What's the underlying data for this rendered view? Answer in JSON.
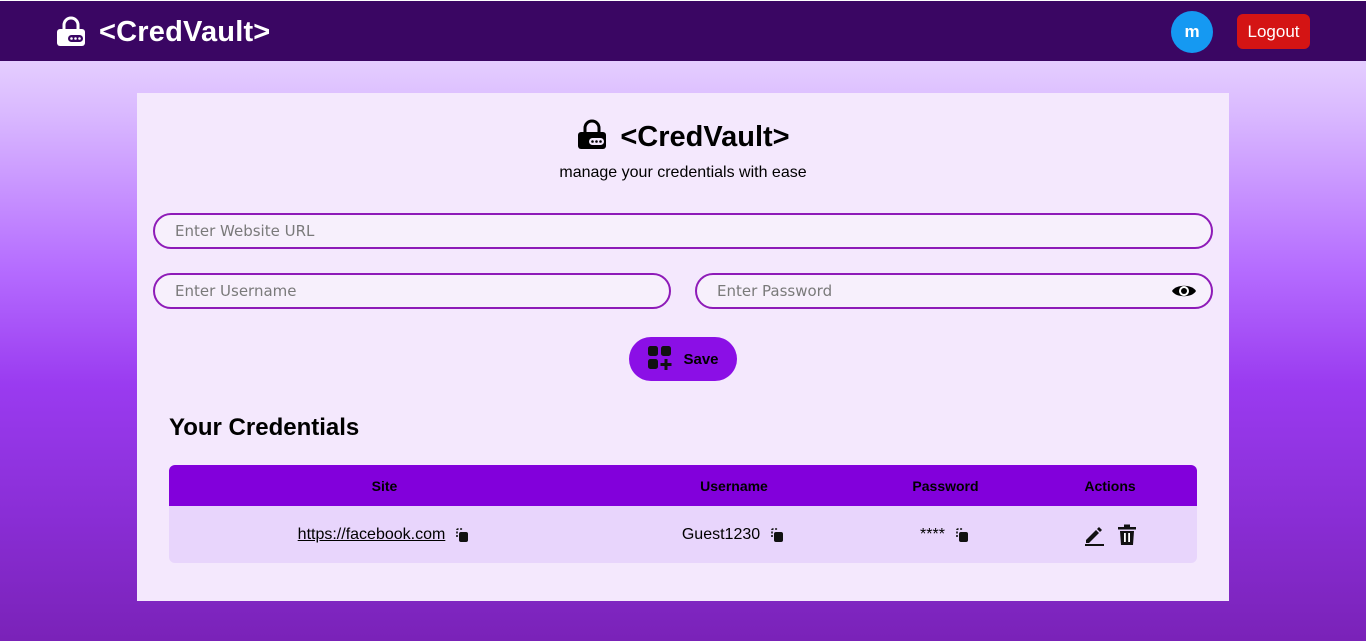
{
  "nav": {
    "brand": "<CredVault>",
    "avatar_letter": "m",
    "logout_label": "Logout"
  },
  "hero": {
    "brand": "<CredVault>",
    "subtitle": "manage your credentials with ease"
  },
  "form": {
    "url_placeholder": "Enter Website URL",
    "username_placeholder": "Enter Username",
    "password_placeholder": "Enter Password",
    "save_label": "Save"
  },
  "credentials": {
    "heading": "Your Credentials",
    "columns": [
      "Site",
      "Username",
      "Password",
      "Actions"
    ],
    "rows": [
      {
        "site": "https://facebook.com",
        "username": "Guest1230",
        "password": "****"
      }
    ]
  },
  "icons": {
    "brand": "lock-icon",
    "password_toggle": "eye-icon",
    "save": "add-grid-icon",
    "copy": "copy-icon",
    "edit": "edit-icon",
    "delete": "trash-icon"
  },
  "colors": {
    "navbar": "#3a0663",
    "accent": "#8200db",
    "save_button": "#8b0fe6",
    "avatar": "#1599f2",
    "logout": "#d41414",
    "card": "#f4e8fd",
    "row": "#e8d5fc",
    "field_border": "#8e1bb8"
  }
}
